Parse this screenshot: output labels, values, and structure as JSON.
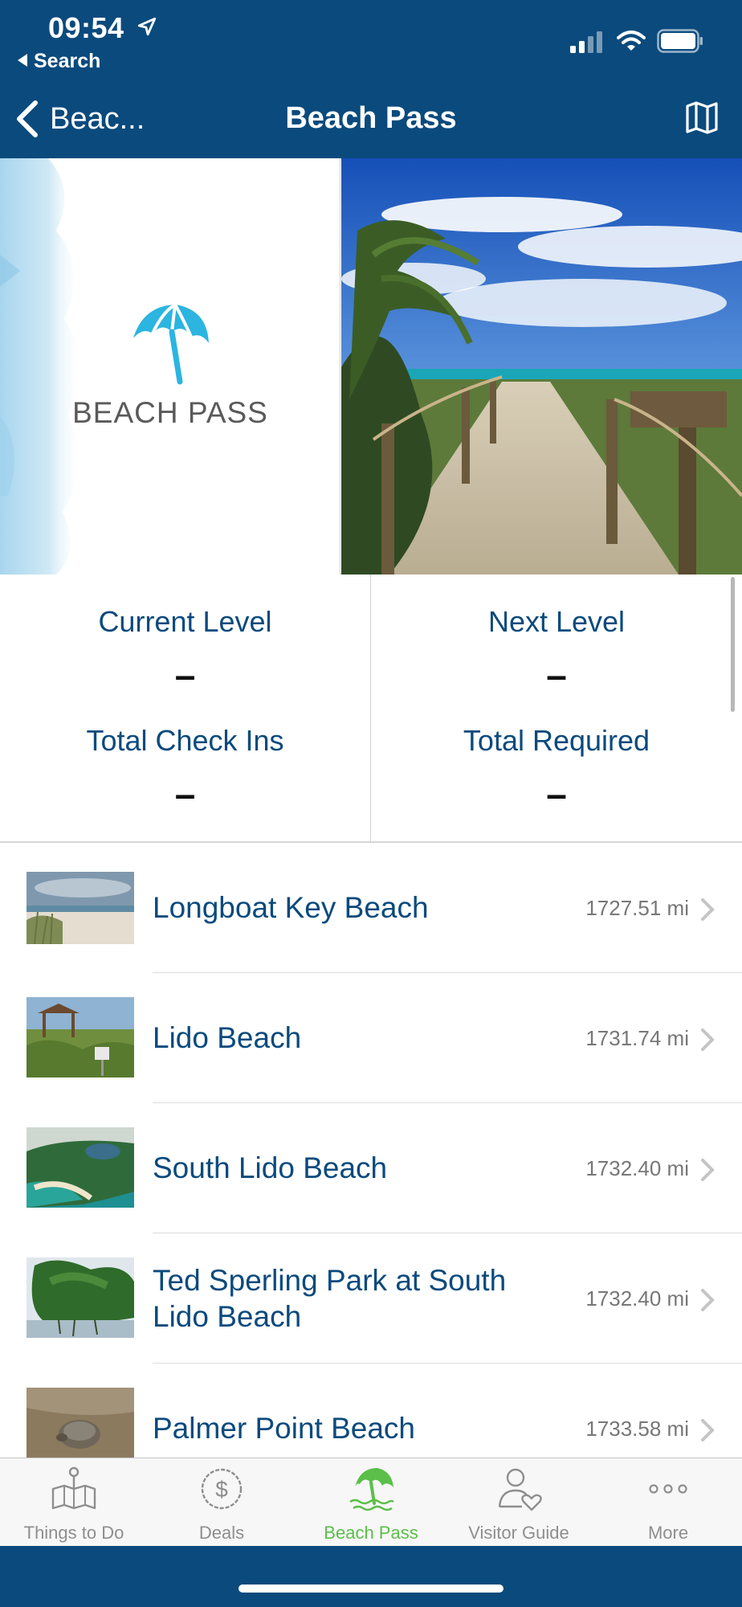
{
  "status_bar": {
    "time": "09:54",
    "back_label": "Search",
    "icons": [
      "location-arrow-icon",
      "cellular-signal-icon",
      "wifi-icon",
      "battery-icon"
    ]
  },
  "nav": {
    "back_label": "Beac...",
    "title": "Beach Pass",
    "right_icon": "map-icon"
  },
  "hero": {
    "logo_text": "BEACH PASS",
    "logo_color": "#2bb5e0"
  },
  "stats": {
    "current_level_label": "Current Level",
    "current_level_value": "–",
    "next_level_label": "Next Level",
    "next_level_value": "–",
    "total_checkins_label": "Total Check Ins",
    "total_checkins_value": "–",
    "total_required_label": "Total Required",
    "total_required_value": "–"
  },
  "beaches": [
    {
      "name": "Longboat Key Beach",
      "distance": "1727.51 mi"
    },
    {
      "name": "Lido Beach",
      "distance": "1731.74 mi"
    },
    {
      "name": "South Lido Beach",
      "distance": "1732.40 mi"
    },
    {
      "name": "Ted Sperling Park at South Lido Beach",
      "distance": "1732.40 mi"
    },
    {
      "name": "Palmer Point Beach",
      "distance": "1733.58 mi"
    }
  ],
  "tabbar": {
    "tabs": [
      {
        "label": "Things to Do",
        "icon": "map-pin-icon"
      },
      {
        "label": "Deals",
        "icon": "dollar-icon"
      },
      {
        "label": "Beach Pass",
        "icon": "beach-umbrella-icon",
        "active": true
      },
      {
        "label": "Visitor Guide",
        "icon": "visitor-heart-icon"
      },
      {
        "label": "More",
        "icon": "more-dots-icon"
      }
    ]
  },
  "colors": {
    "brand_blue": "#0b4a7d",
    "active_green": "#5bbf4a",
    "inactive_gray": "#8e8e8e"
  }
}
